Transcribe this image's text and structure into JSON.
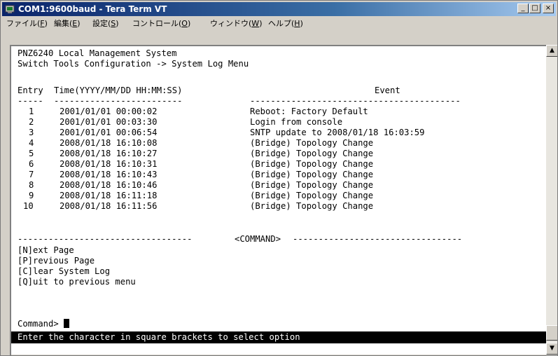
{
  "window": {
    "title": "COM1:9600baud - Tera Term VT",
    "controls": {
      "minimize": "_",
      "maximize": "□",
      "close": "×"
    }
  },
  "menu": [
    {
      "label": "ファイル",
      "accel": "F"
    },
    {
      "label": "編集",
      "accel": "E"
    },
    {
      "label": "設定",
      "accel": "S"
    },
    {
      "label": "コントロール",
      "accel": "O"
    },
    {
      "label": "ウィンドウ",
      "accel": "W"
    },
    {
      "label": "ヘルプ",
      "accel": "H"
    }
  ],
  "terminal": {
    "system_name": "PNZ6240 Local Management System",
    "path": "Switch Tools Configuration -> System Log Menu",
    "columns": {
      "entry": "Entry",
      "time": "Time(YYYY/MM/DD HH:MM:SS)",
      "event": "Event"
    },
    "rows": [
      {
        "entry": "1",
        "time": "2001/01/01 00:00:02",
        "event": "Reboot: Factory Default"
      },
      {
        "entry": "2",
        "time": "2001/01/01 00:03:30",
        "event": "Login from console"
      },
      {
        "entry": "3",
        "time": "2001/01/01 00:06:54",
        "event": "SNTP update to 2008/01/18 16:03:59"
      },
      {
        "entry": "4",
        "time": "2008/01/18 16:10:08",
        "event": "(Bridge) Topology Change"
      },
      {
        "entry": "5",
        "time": "2008/01/18 16:10:27",
        "event": "(Bridge) Topology Change"
      },
      {
        "entry": "6",
        "time": "2008/01/18 16:10:31",
        "event": "(Bridge) Topology Change"
      },
      {
        "entry": "7",
        "time": "2008/01/18 16:10:43",
        "event": "(Bridge) Topology Change"
      },
      {
        "entry": "8",
        "time": "2008/01/18 16:10:46",
        "event": "(Bridge) Topology Change"
      },
      {
        "entry": "9",
        "time": "2008/01/18 16:11:18",
        "event": "(Bridge) Topology Change"
      },
      {
        "entry": "10",
        "time": "2008/01/18 16:11:56",
        "event": "(Bridge) Topology Change"
      }
    ],
    "command_divider_label": "<COMMAND>",
    "commands": [
      "[N]ext Page",
      "[P]revious Page",
      "[C]lear System Log",
      "[Q]uit to previous menu"
    ],
    "prompt": "Command>",
    "status": "Enter the character in square brackets to select option"
  },
  "scrollbar": {
    "up": "▲",
    "down": "▼"
  }
}
